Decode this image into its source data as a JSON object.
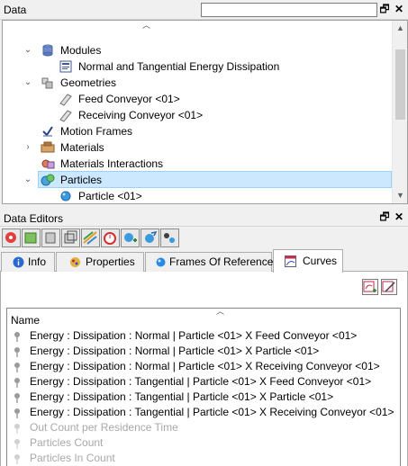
{
  "data_panel": {
    "title": "Data",
    "search_value": "",
    "restore_glyph": "🗗",
    "close_glyph": "✕",
    "tree": [
      {
        "label": "Modules",
        "icon": "modules-icon",
        "expanded": true
      },
      {
        "label": "Normal and Tangential Energy Dissipation",
        "icon": "document-icon"
      },
      {
        "label": "Geometries",
        "icon": "geometries-icon",
        "expanded": true
      },
      {
        "label": "Feed Conveyor <01>",
        "icon": "conveyor-icon"
      },
      {
        "label": "Receiving Conveyor <01>",
        "icon": "conveyor-icon"
      },
      {
        "label": "Motion Frames",
        "icon": "motion-frames-icon"
      },
      {
        "label": "Materials",
        "icon": "materials-icon",
        "expanded": false
      },
      {
        "label": "Materials Interactions",
        "icon": "materials-interactions-icon"
      },
      {
        "label": "Particles",
        "icon": "particles-icon",
        "expanded": true,
        "selected": true
      },
      {
        "label": "Particle <01>",
        "icon": "particle-icon"
      }
    ]
  },
  "editors_panel": {
    "title": "Data Editors",
    "restore_glyph": "🗗",
    "close_glyph": "✕",
    "tabs": [
      {
        "label": "Info",
        "icon": "info-icon"
      },
      {
        "label": "Properties",
        "icon": "properties-icon"
      },
      {
        "label": "Frames Of Reference",
        "icon": "frames-icon"
      },
      {
        "label": "Curves",
        "icon": "curves-icon",
        "active": true
      }
    ],
    "list_header": "Name",
    "curves": [
      {
        "label": "Energy : Dissipation : Normal | Particle <01> X Feed Conveyor <01>",
        "enabled": true
      },
      {
        "label": "Energy : Dissipation : Normal | Particle <01> X Particle <01>",
        "enabled": true
      },
      {
        "label": "Energy : Dissipation : Normal | Particle <01> X Receiving Conveyor <01>",
        "enabled": true
      },
      {
        "label": "Energy : Dissipation : Tangential | Particle <01> X Feed Conveyor <01>",
        "enabled": true
      },
      {
        "label": "Energy : Dissipation : Tangential | Particle <01> X Particle <01>",
        "enabled": true
      },
      {
        "label": "Energy : Dissipation : Tangential | Particle <01> X Receiving Conveyor <01>",
        "enabled": true
      },
      {
        "label": "Out Count per Residence Time",
        "enabled": false
      },
      {
        "label": "Particles Count",
        "enabled": false
      },
      {
        "label": "Particles In Count",
        "enabled": false
      }
    ]
  },
  "colors": {
    "selection": "#cce8ff",
    "selection_border": "#99d1ff",
    "disabled_text": "#a8a8a8"
  }
}
